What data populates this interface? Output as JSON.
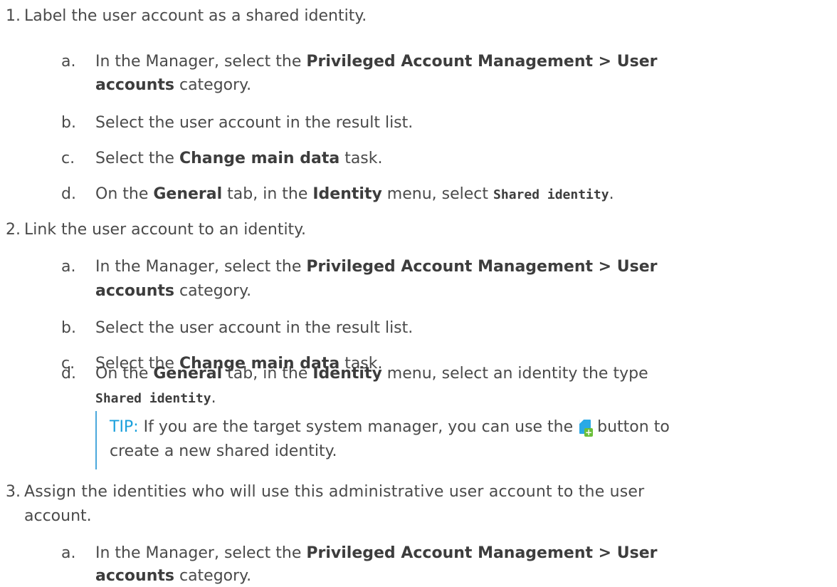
{
  "steps": [
    {
      "num": "1.",
      "text": "Label the user account as a shared identity.",
      "sub": [
        {
          "letter": "a.",
          "pre": "In the Manager, select the ",
          "bold": "Privileged Account Management > User",
          "bold2": "accounts",
          "post": " category."
        },
        {
          "letter": "b.",
          "text": "Select the user account in the result list."
        },
        {
          "letter": "c.",
          "pre": "Select the ",
          "bold": "Change main data",
          "post": " task."
        },
        {
          "letter": "d.",
          "pre": "On the ",
          "bold": "General",
          "mid": " tab, in the ",
          "bold2": "Identity",
          "mid2": " menu, select ",
          "code": "Shared identity",
          "post": "."
        }
      ]
    },
    {
      "num": "2.",
      "text": "Link the user account to an identity.",
      "sub": [
        {
          "letter": "a.",
          "pre": "In the Manager, select the ",
          "bold": "Privileged Account Management > User",
          "bold2": "accounts",
          "post": " category."
        },
        {
          "letter": "b.",
          "text": "Select the user account in the result list."
        },
        {
          "letter": "c.",
          "pre": "Select the ",
          "bold": "Change main data",
          "post": " task."
        },
        {
          "letter": "d.",
          "pre": "On the ",
          "bold": "General",
          "mid": " tab, in the ",
          "bold2": "Identity",
          "mid2": " menu, select an identity the type",
          "code": "Shared identity",
          "post": "."
        }
      ],
      "tip": {
        "label": "TIP:",
        "line1_pre": " If you are the target system manager, you can use the ",
        "line1_post": " button to",
        "line2": "create a new shared identity.",
        "icon": "new-item-icon"
      }
    },
    {
      "num": "3.",
      "text_line1": "Assign the identities who will use this administrative user account to the user",
      "text_line2": "account.",
      "sub": [
        {
          "letter": "a.",
          "pre": "In the Manager, select the ",
          "bold": "Privileged Account Management > User",
          "bold2": "accounts",
          "post": " category."
        }
      ]
    }
  ],
  "colors": {
    "text": "#4a4a4a",
    "tip": "#1aa0dc",
    "tip_border": "#4aa8dc",
    "icon_blue": "#2aa9e6",
    "icon_green": "#6bbf3a"
  }
}
